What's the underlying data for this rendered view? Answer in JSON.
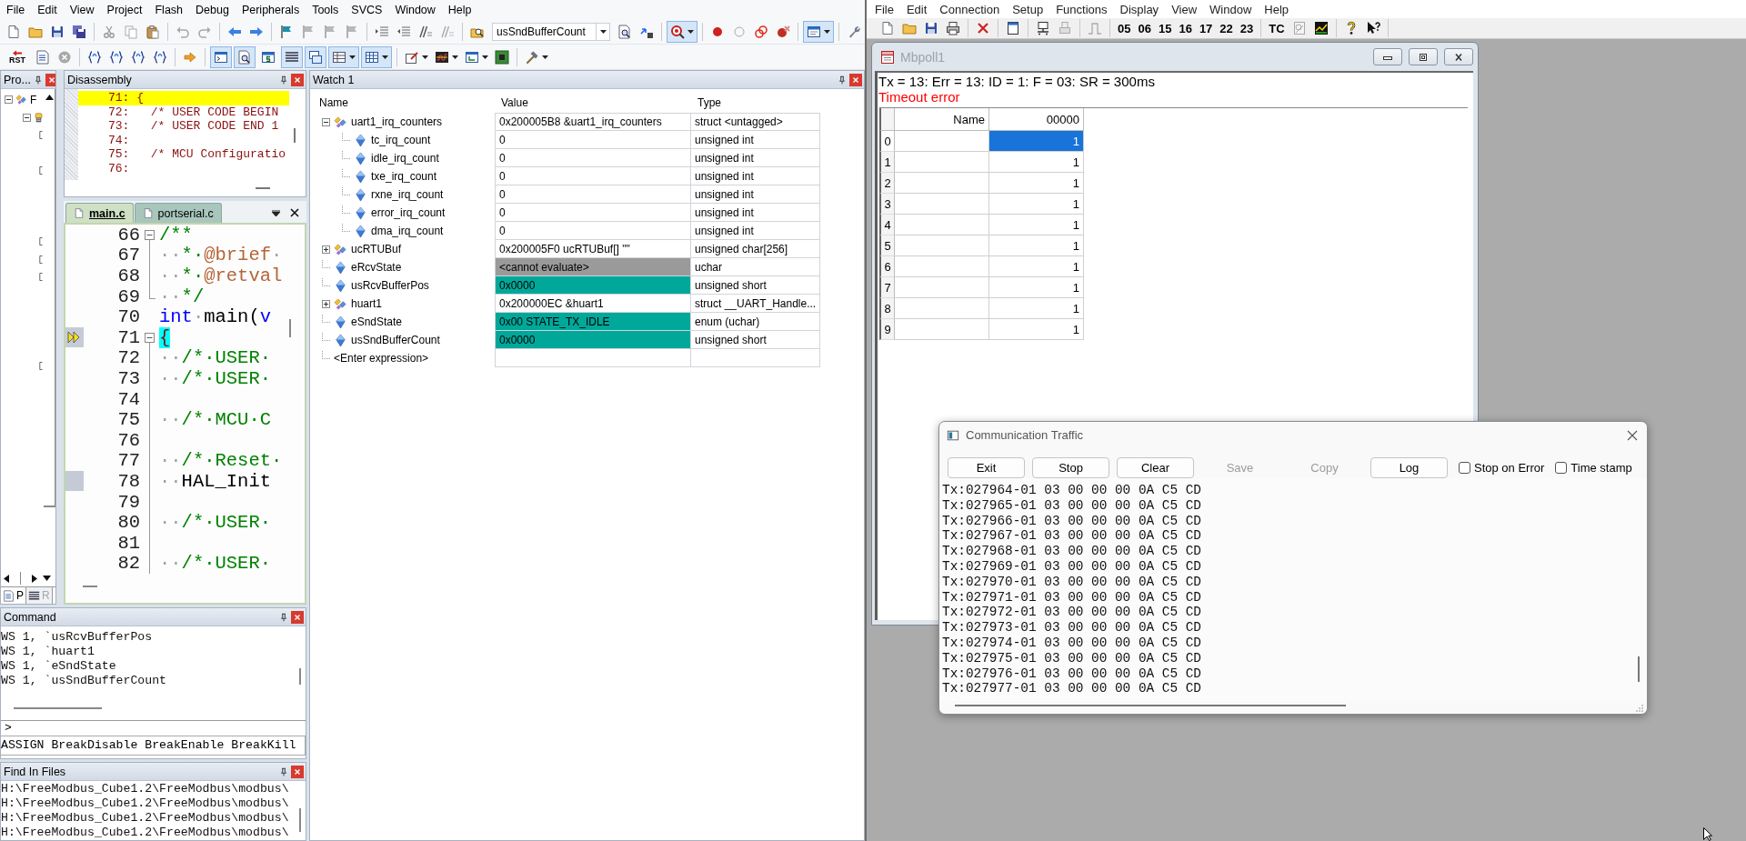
{
  "ide": {
    "menu": [
      "File",
      "Edit",
      "View",
      "Project",
      "Flash",
      "Debug",
      "Peripherals",
      "Tools",
      "SVCS",
      "Window",
      "Help"
    ],
    "toolbar_1": {
      "symbol_combo": "usSndBufferCount",
      "toggles": [
        {
          "on": true
        },
        {
          "on": true
        }
      ]
    },
    "toolbar_2": {
      "reset_label": "RST",
      "toggles": [
        {
          "on": true
        },
        {
          "on": true
        },
        {
          "on": false
        },
        {
          "on": true
        },
        {
          "on": true
        },
        {
          "on": true
        },
        {
          "on": true
        }
      ]
    },
    "project": {
      "title": "Pro...",
      "tree": [
        {
          "label": "F",
          "expanded": true,
          "children": [
            {
              "expanded": true,
              "children": [
                {
                  "kind": "group"
                },
                {
                  "kind": "blank"
                },
                {
                  "kind": "group"
                },
                {
                  "kind": "blank"
                },
                {
                  "kind": "blank"
                },
                {
                  "kind": "blank"
                },
                {
                  "kind": "group"
                },
                {
                  "kind": "group"
                },
                {
                  "kind": "group"
                },
                {
                  "kind": "blank"
                },
                {
                  "kind": "blank"
                },
                {
                  "kind": "blank"
                },
                {
                  "kind": "blank"
                },
                {
                  "kind": "group"
                }
              ]
            }
          ]
        }
      ],
      "tabs": [
        {
          "label": "P",
          "selected": true
        },
        {
          "label": "R",
          "selected": false
        }
      ]
    },
    "disassembly": {
      "title": "Disassembly",
      "lines": [
        {
          "text": "71: {",
          "current": true
        },
        {
          "text": "72:   /* USER CODE BEGIN",
          "current": false
        },
        {
          "text": "73:   /* USER CODE END 1",
          "current": false
        },
        {
          "text": "74:",
          "current": false
        },
        {
          "text": "75:   /* MCU Configuratio",
          "current": false
        },
        {
          "text": "76:",
          "current": false
        }
      ]
    },
    "editor": {
      "tabs": [
        {
          "label": "main.c",
          "selected": true
        },
        {
          "label": "portserial.c",
          "selected": false
        }
      ],
      "lines": [
        {
          "number": "66",
          "kind": "start",
          "current": false,
          "marked": false,
          "segments": [
            {
              "text": "/**",
              "kind": "comment"
            }
          ]
        },
        {
          "number": "67",
          "kind": "inner",
          "current": false,
          "marked": false,
          "segments": [
            {
              "text": "··",
              "kind": "space"
            },
            {
              "text": "*·",
              "kind": "comment"
            },
            {
              "text": "@brief",
              "kind": "doctag"
            },
            {
              "text": "·",
              "kind": "space"
            }
          ]
        },
        {
          "number": "68",
          "kind": "inner",
          "current": false,
          "marked": false,
          "segments": [
            {
              "text": "··",
              "kind": "space"
            },
            {
              "text": "*·",
              "kind": "comment"
            },
            {
              "text": "@retval",
              "kind": "doctag"
            }
          ]
        },
        {
          "number": "69",
          "kind": "end",
          "current": false,
          "marked": false,
          "segments": [
            {
              "text": "··",
              "kind": "space"
            },
            {
              "text": "*/",
              "kind": "comment"
            }
          ]
        },
        {
          "number": "70",
          "kind": "plain",
          "current": false,
          "marked": false,
          "segments": [
            {
              "text": "int",
              "kind": "keyword"
            },
            {
              "text": "·",
              "kind": "space"
            },
            {
              "text": "main(",
              "kind": "plain"
            },
            {
              "text": "v",
              "kind": "keyword"
            }
          ]
        },
        {
          "number": "71",
          "kind": "start",
          "current": true,
          "marked": false,
          "segments": [
            {
              "text": "{",
              "kind": "brace_match"
            }
          ]
        },
        {
          "number": "72",
          "kind": "inner",
          "current": false,
          "marked": false,
          "segments": [
            {
              "text": "··",
              "kind": "space"
            },
            {
              "text": "/*·USER·",
              "kind": "comment"
            }
          ]
        },
        {
          "number": "73",
          "kind": "inner",
          "current": false,
          "marked": false,
          "segments": [
            {
              "text": "··",
              "kind": "space"
            },
            {
              "text": "/*·USER·",
              "kind": "comment"
            }
          ]
        },
        {
          "number": "74",
          "kind": "inner",
          "current": false,
          "marked": false
        },
        {
          "number": "75",
          "kind": "inner",
          "current": false,
          "marked": false,
          "segments": [
            {
              "text": "··",
              "kind": "space"
            },
            {
              "text": "/*·MCU·C",
              "kind": "comment"
            }
          ]
        },
        {
          "number": "76",
          "kind": "inner",
          "current": false,
          "marked": false
        },
        {
          "number": "77",
          "kind": "inner",
          "current": false,
          "marked": false,
          "segments": [
            {
              "text": "··",
              "kind": "space"
            },
            {
              "text": "/*·Reset·",
              "kind": "comment"
            }
          ]
        },
        {
          "number": "78",
          "kind": "inner",
          "current": false,
          "marked": true,
          "segments": [
            {
              "text": "··",
              "kind": "space"
            },
            {
              "text": "HAL_Init",
              "kind": "plain"
            }
          ]
        },
        {
          "number": "79",
          "kind": "inner",
          "current": false,
          "marked": false
        },
        {
          "number": "80",
          "kind": "inner",
          "current": false,
          "marked": false,
          "segments": [
            {
              "text": "··",
              "kind": "space"
            },
            {
              "text": "/*·USER·",
              "kind": "comment"
            }
          ]
        },
        {
          "number": "81",
          "kind": "inner",
          "current": false,
          "marked": false
        },
        {
          "number": "82",
          "kind": "inner",
          "current": false,
          "marked": false,
          "segments": [
            {
              "text": "··",
              "kind": "space"
            },
            {
              "text": "/*·USER·",
              "kind": "comment"
            }
          ]
        }
      ]
    },
    "watch": {
      "title": "Watch 1",
      "columns": [
        "Name",
        "Value",
        "Type"
      ],
      "rows": [
        {
          "name": "uart1_irq_counters",
          "value": "0x200005B8 &uart1_irq_counters",
          "type": "struct <untagged>",
          "kind": "struct",
          "expanded": true,
          "changed": false,
          "invalid": false,
          "children": [
            {
              "name": "tc_irq_count",
              "value": "0",
              "type": "unsigned int",
              "kind": "member",
              "changed": false,
              "invalid": false
            },
            {
              "name": "idle_irq_count",
              "value": "0",
              "type": "unsigned int",
              "kind": "member",
              "changed": false,
              "invalid": false
            },
            {
              "name": "txe_irq_count",
              "value": "0",
              "type": "unsigned int",
              "kind": "member",
              "changed": false,
              "invalid": false
            },
            {
              "name": "rxne_irq_count",
              "value": "0",
              "type": "unsigned int",
              "kind": "member",
              "changed": false,
              "invalid": false
            },
            {
              "name": "error_irq_count",
              "value": "0",
              "type": "unsigned int",
              "kind": "member",
              "changed": false,
              "invalid": false
            },
            {
              "name": "dma_irq_count",
              "value": "0",
              "type": "unsigned int",
              "kind": "member",
              "changed": false,
              "invalid": false
            }
          ]
        },
        {
          "name": "ucRTUBuf",
          "value": "0x200005F0 ucRTUBuf[] \"\"",
          "type": "unsigned char[256]",
          "kind": "struct",
          "expanded": false,
          "changed": false,
          "invalid": false
        },
        {
          "name": "eRcvState",
          "value": "<cannot evaluate>",
          "type": "uchar",
          "kind": "member",
          "changed": false,
          "invalid": true
        },
        {
          "name": "usRcvBufferPos",
          "value": "0x0000",
          "type": "unsigned short",
          "kind": "member",
          "changed": true,
          "invalid": false
        },
        {
          "name": "huart1",
          "value": "0x200000EC &huart1",
          "type": "struct __UART_Handle...",
          "kind": "struct",
          "expanded": false,
          "changed": false,
          "invalid": false
        },
        {
          "name": "eSndState",
          "value": "0x00 STATE_TX_IDLE",
          "type": "enum (uchar)",
          "kind": "member",
          "changed": true,
          "invalid": false
        },
        {
          "name": "usSndBufferCount",
          "value": "0x0000",
          "type": "unsigned short",
          "kind": "member",
          "changed": true,
          "invalid": false
        },
        {
          "name": "<Enter expression>",
          "kind": "entry",
          "changed": false,
          "invalid": false
        }
      ]
    },
    "command": {
      "title": "Command",
      "lines": [
        "WS 1, `usRcvBufferPos",
        "WS 1, `huart1",
        "WS 1, `eSndState",
        "WS 1, `usSndBufferCount"
      ],
      "prompt": ">",
      "hint": "ASSIGN BreakDisable BreakEnable BreakKill"
    },
    "find_in_files": {
      "title": "Find In Files",
      "lines": [
        "H:\\FreeModbus_Cube1.2\\FreeModbus\\modbus\\",
        "H:\\FreeModbus_Cube1.2\\FreeModbus\\modbus\\",
        "H:\\FreeModbus_Cube1.2\\FreeModbus\\modbus\\",
        "H:\\FreeModbus_Cube1.2\\FreeModbus\\modbus\\"
      ]
    }
  },
  "modbus_poll": {
    "menu": [
      "File",
      "Edit",
      "Connection",
      "Setup",
      "Functions",
      "Display",
      "View",
      "Window",
      "Help"
    ],
    "function_codes": [
      "05",
      "06",
      "15",
      "16",
      "17",
      "22",
      "23"
    ],
    "tc_label": "TC",
    "document": {
      "title": "Mbpoll1",
      "active": false,
      "status": "Tx = 13: Err = 13: ID = 1: F = 03: SR = 300ms",
      "error": "Timeout error",
      "columns": [
        "Name",
        "00000"
      ],
      "rows": [
        {
          "index": "0",
          "value": "1",
          "selected": true
        },
        {
          "index": "1",
          "value": "1",
          "selected": false
        },
        {
          "index": "2",
          "value": "1",
          "selected": false
        },
        {
          "index": "3",
          "value": "1",
          "selected": false
        },
        {
          "index": "4",
          "value": "1",
          "selected": false
        },
        {
          "index": "5",
          "value": "1",
          "selected": false
        },
        {
          "index": "6",
          "value": "1",
          "selected": false
        },
        {
          "index": "7",
          "value": "1",
          "selected": false
        },
        {
          "index": "8",
          "value": "1",
          "selected": false
        },
        {
          "index": "9",
          "value": "1",
          "selected": false
        }
      ]
    },
    "traffic": {
      "title": "Communication Traffic",
      "buttons": [
        {
          "label": "Exit",
          "disabled": false
        },
        {
          "label": "Stop",
          "disabled": false
        },
        {
          "label": "Clear",
          "disabled": false
        },
        {
          "label": "Save",
          "disabled": true
        },
        {
          "label": "Copy",
          "disabled": true
        },
        {
          "label": "Log",
          "disabled": false
        }
      ],
      "checkboxes": [
        {
          "label": "Stop on Error",
          "checked": false
        },
        {
          "label": "Time stamp",
          "checked": false
        }
      ],
      "lines": [
        "Tx:027964-01 03 00 00 00 0A C5 CD",
        "Tx:027965-01 03 00 00 00 0A C5 CD",
        "Tx:027966-01 03 00 00 00 0A C5 CD",
        "Tx:027967-01 03 00 00 00 0A C5 CD",
        "Tx:027968-01 03 00 00 00 0A C5 CD",
        "Tx:027969-01 03 00 00 00 0A C5 CD",
        "Tx:027970-01 03 00 00 00 0A C5 CD",
        "Tx:027971-01 03 00 00 00 0A C5 CD",
        "Tx:027972-01 03 00 00 00 0A C5 CD",
        "Tx:027973-01 03 00 00 00 0A C5 CD",
        "Tx:027974-01 03 00 00 00 0A C5 CD",
        "Tx:027975-01 03 00 00 00 0A C5 CD",
        "Tx:027976-01 03 00 00 00 0A C5 CD",
        "Tx:027977-01 03 00 00 00 0A C5 CD"
      ]
    }
  }
}
